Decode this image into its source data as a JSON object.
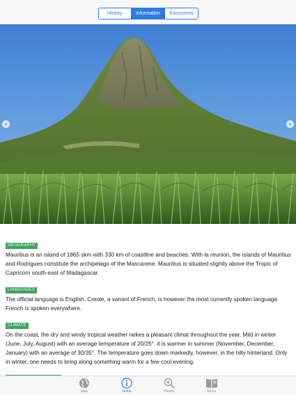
{
  "segmented": {
    "items": [
      {
        "label": "History",
        "active": false
      },
      {
        "label": "Information",
        "active": true
      },
      {
        "label": "Excursions",
        "active": false
      }
    ]
  },
  "carousel": {
    "prev_icon": "chevron-left-icon",
    "next_icon": "chevron-right-icon"
  },
  "sections": [
    {
      "tag": "GEOGRAPHY",
      "text": "Mauritius is an island of 1865 skm with 330 km of coastline and beaches. With la reunion, the islands of Mauritius and Rodrigues constitute the archipelago of the Mascarene. Mauritius is situated slightly above the Tropic of Capricorn south-east of Madagascar."
    },
    {
      "tag": "LANGUAGES",
      "text": "The official language is English. Creole, a variant of French, is however the most currently spoken language. French is spoken everywhere."
    },
    {
      "tag": "CLIMATE",
      "text": "On the coast, the dry and windy tropical weather nekes a pleasant climat throughout the year. Mild in winter (June, July, August) with an average temperature of 20/25°. it is warmer in summer (November, December, January) with an average of 30/35°. The temperature goes down markedly, however, in the hilly hinterland. Only in winter, one needs to bring along something warm for a few cool evening."
    }
  ],
  "tabbar": {
    "items": [
      {
        "label": "Map",
        "icon": "globe-icon",
        "active": false
      },
      {
        "label": "Guide",
        "icon": "info-icon",
        "active": true
      },
      {
        "label": "Places",
        "icon": "magnifier-icon",
        "active": false
      },
      {
        "label": "Menu",
        "icon": "book-icon",
        "active": false
      }
    ]
  },
  "colors": {
    "accent": "#2a7de1",
    "tag_green": "#3aa55b"
  }
}
